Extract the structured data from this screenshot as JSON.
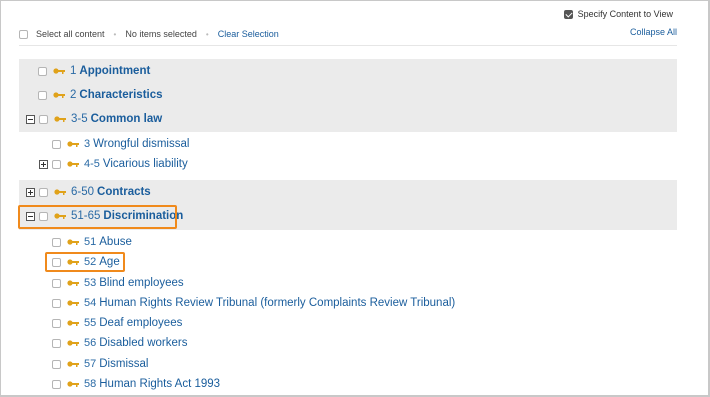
{
  "header": {
    "specify_label": "Specify Content to View",
    "specify_checked": true
  },
  "toolbar": {
    "select_all_label": "Select all content",
    "no_items_label": "No items selected",
    "clear_label": "Clear Selection",
    "collapse_label": "Collapse All"
  },
  "tree": {
    "items": [
      {
        "num": "1",
        "title": "Appointment"
      },
      {
        "num": "2",
        "title": "Characteristics"
      },
      {
        "num": "3-5",
        "title": "Common law"
      },
      {
        "num": "3",
        "title": "Wrongful dismissal"
      },
      {
        "num": "4-5",
        "title": "Vicarious liability"
      },
      {
        "num": "6-50",
        "title": "Contracts"
      },
      {
        "num": "51-65",
        "title": "Discrimination"
      },
      {
        "num": "51",
        "title": "Abuse"
      },
      {
        "num": "52",
        "title": "Age"
      },
      {
        "num": "53",
        "title": "Blind employees"
      },
      {
        "num": "54",
        "title": "Human Rights Review Tribunal (formerly Complaints Review Tribunal)"
      },
      {
        "num": "55",
        "title": "Deaf employees"
      },
      {
        "num": "56",
        "title": "Disabled workers"
      },
      {
        "num": "57",
        "title": "Dismissal"
      },
      {
        "num": "58",
        "title": "Human Rights Act 1993"
      }
    ]
  },
  "colors": {
    "link": "#1a5d9c",
    "highlight": "#f08a1c",
    "band": "#ebebeb",
    "key_icon": "#e0a21a"
  }
}
